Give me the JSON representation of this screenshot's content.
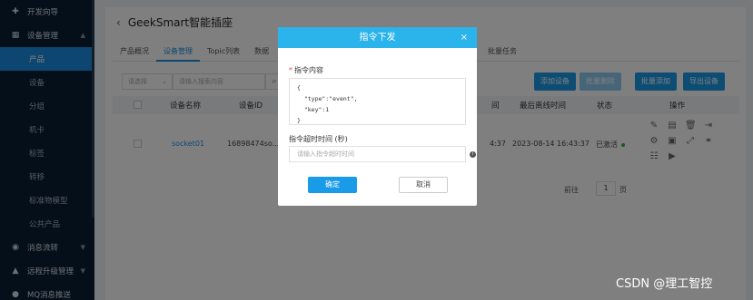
{
  "sidebar": {
    "items": [
      {
        "label": "开发向导",
        "type": "group",
        "icon": "wrench-icon",
        "active": false
      },
      {
        "label": "设备管理",
        "type": "group",
        "icon": "grid-icon",
        "active": false
      },
      {
        "label": "产品",
        "type": "item",
        "active": true
      },
      {
        "label": "设备",
        "type": "item",
        "active": false
      },
      {
        "label": "分组",
        "type": "item",
        "active": false
      },
      {
        "label": "机卡",
        "type": "item",
        "active": false
      },
      {
        "label": "标签",
        "type": "item",
        "active": false
      },
      {
        "label": "转移",
        "type": "item",
        "active": false
      },
      {
        "label": "标准物模型",
        "type": "item",
        "active": false
      },
      {
        "label": "公共产品",
        "type": "item",
        "active": false
      },
      {
        "label": "消息流转",
        "type": "group",
        "icon": "flow-icon",
        "active": false
      },
      {
        "label": "远程升级管理",
        "type": "group",
        "icon": "lock-icon",
        "active": false
      },
      {
        "label": "MQ消息推送",
        "type": "group",
        "icon": "message-icon",
        "active": false
      }
    ]
  },
  "page": {
    "title": "GeekSmart智能插座",
    "tabs": [
      "产品概况",
      "设备管理",
      "Topic列表",
      "数据"
    ],
    "tab_right": "批量任务",
    "active_tab": "设备管理"
  },
  "toolbar": {
    "select_placeholder": "请选择",
    "search_placeholder": "请输入搜索内容",
    "buttons": [
      "添加设备",
      "批量删除",
      "批量添加",
      "导出设备"
    ]
  },
  "table": {
    "headers": [
      "设备名称",
      "设备ID",
      "间",
      "最后离线时间",
      "状态",
      "操作"
    ],
    "rows": [
      {
        "name": "socket01",
        "id": "16898474so...",
        "time_partial": "4:37",
        "offline": "2023-08-14 16:43:37",
        "status": "已激活"
      }
    ]
  },
  "pager": {
    "label": "前往",
    "page": "1",
    "suffix": "页"
  },
  "dialog": {
    "title": "指令下发",
    "content_label": "指令内容",
    "code_lines": [
      "{",
      "  \"type\":\"event\",",
      "  \"key\":1",
      "}"
    ],
    "timeout_label": "指令超时时间 (秒)",
    "timeout_placeholder": "请输入指令超时时间",
    "ok_label": "确定",
    "cancel_label": "取消"
  },
  "watermark": "CSDN @理工智控",
  "colors": {
    "primary": "#1a9be8",
    "dialog_header": "#2bb3ec",
    "sidebar_bg": "#0b1f34",
    "active": "#1a8fe3"
  }
}
